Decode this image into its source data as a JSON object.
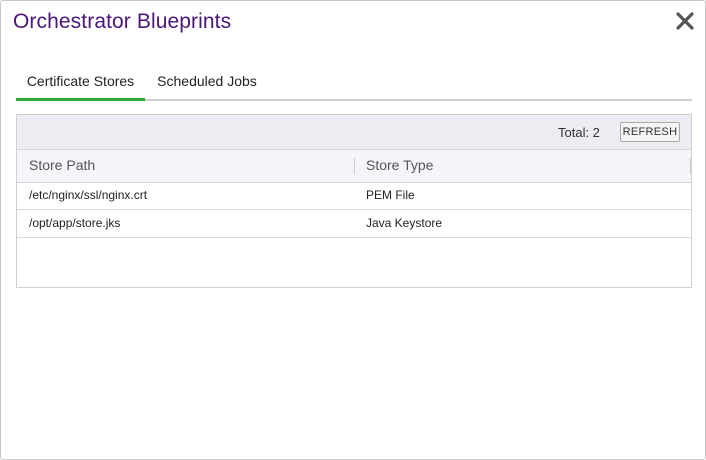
{
  "dialog": {
    "title": "Orchestrator Blueprints",
    "close_icon": "close-x-icon"
  },
  "tabs": [
    {
      "label": "Certificate Stores",
      "active": true
    },
    {
      "label": "Scheduled Jobs",
      "active": false
    }
  ],
  "grid": {
    "total_label": "Total: 2",
    "refresh_label": "REFRESH",
    "columns": [
      "Store Path",
      "Store Type"
    ],
    "rows": [
      {
        "store_path": "/etc/nginx/ssl/nginx.crt",
        "store_type": "PEM File"
      },
      {
        "store_path": "/opt/app/store.jks",
        "store_type": "Java Keystore"
      }
    ]
  },
  "colors": {
    "title": "#4b1579",
    "active_tab_underline": "#2bab3a",
    "toolbar_bg": "#ecedf2"
  }
}
